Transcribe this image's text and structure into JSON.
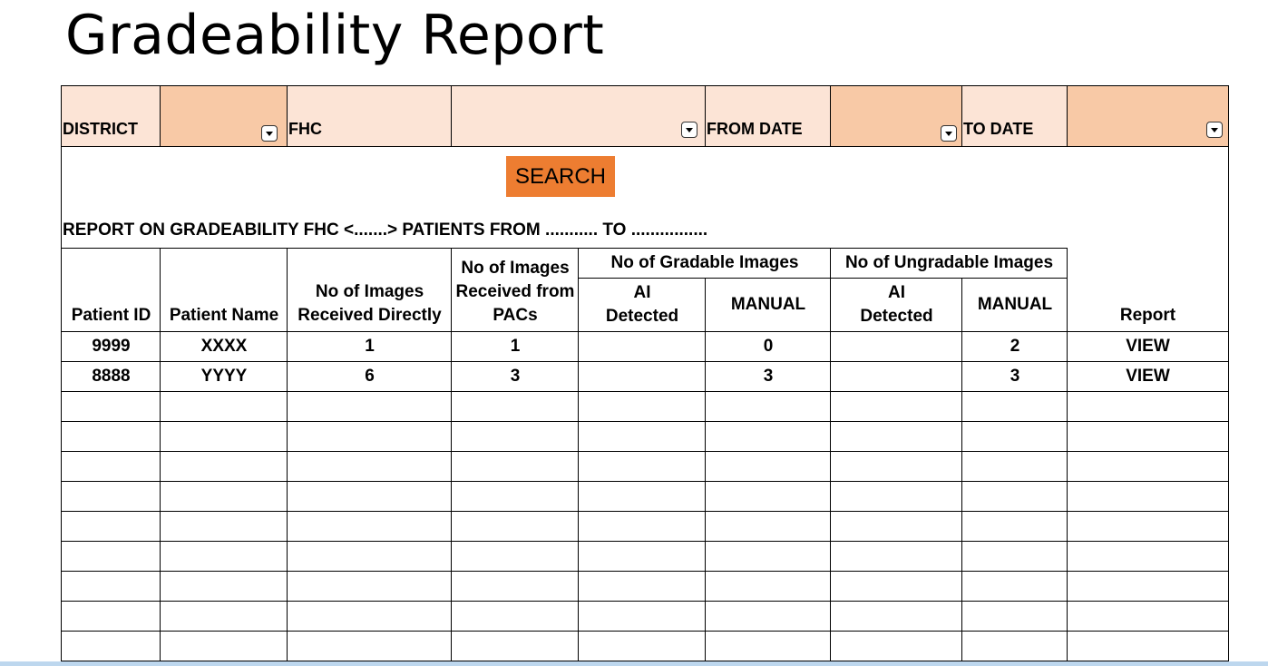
{
  "title": "Gradeability Report",
  "filters": {
    "district_label": "DISTRICT",
    "fhc_label": "FHC",
    "from_date_label": "FROM DATE",
    "to_date_label": "TO DATE"
  },
  "search_label": "SEARCH",
  "report_line": "REPORT ON GRADEABILITY FHC <.......>  PATIENTS FROM ........... TO ................",
  "table": {
    "headers": {
      "patient_id": "Patient ID",
      "patient_name": "Patient Name",
      "images_direct": [
        "No of Images",
        "Received Directly"
      ],
      "images_pacs": [
        "No of Images",
        "Received from",
        "PACs"
      ],
      "gradable_group": "No of Gradable Images",
      "ungradable_group": "No of Ungradable Images",
      "ai_detected": [
        "AI",
        "Detected"
      ],
      "manual": "MANUAL",
      "report": "Report"
    },
    "rows": [
      {
        "patient_id": "9999",
        "patient_name": "XXXX",
        "images_direct": "1",
        "images_pacs": "1",
        "gradable_ai": "",
        "gradable_manual": "0",
        "ungradable_ai": "",
        "ungradable_manual": "2",
        "report": "VIEW"
      },
      {
        "patient_id": "8888",
        "patient_name": "YYYY",
        "images_direct": "6",
        "images_pacs": "3",
        "gradable_ai": "",
        "gradable_manual": "3",
        "ungradable_ai": "",
        "ungradable_manual": "3",
        "report": "VIEW"
      }
    ],
    "empty_rows": 9
  },
  "colors": {
    "filter_input": "#f8c9a6",
    "filter_label_bg": "#fce4d6",
    "search_button": "#ed7d31"
  }
}
